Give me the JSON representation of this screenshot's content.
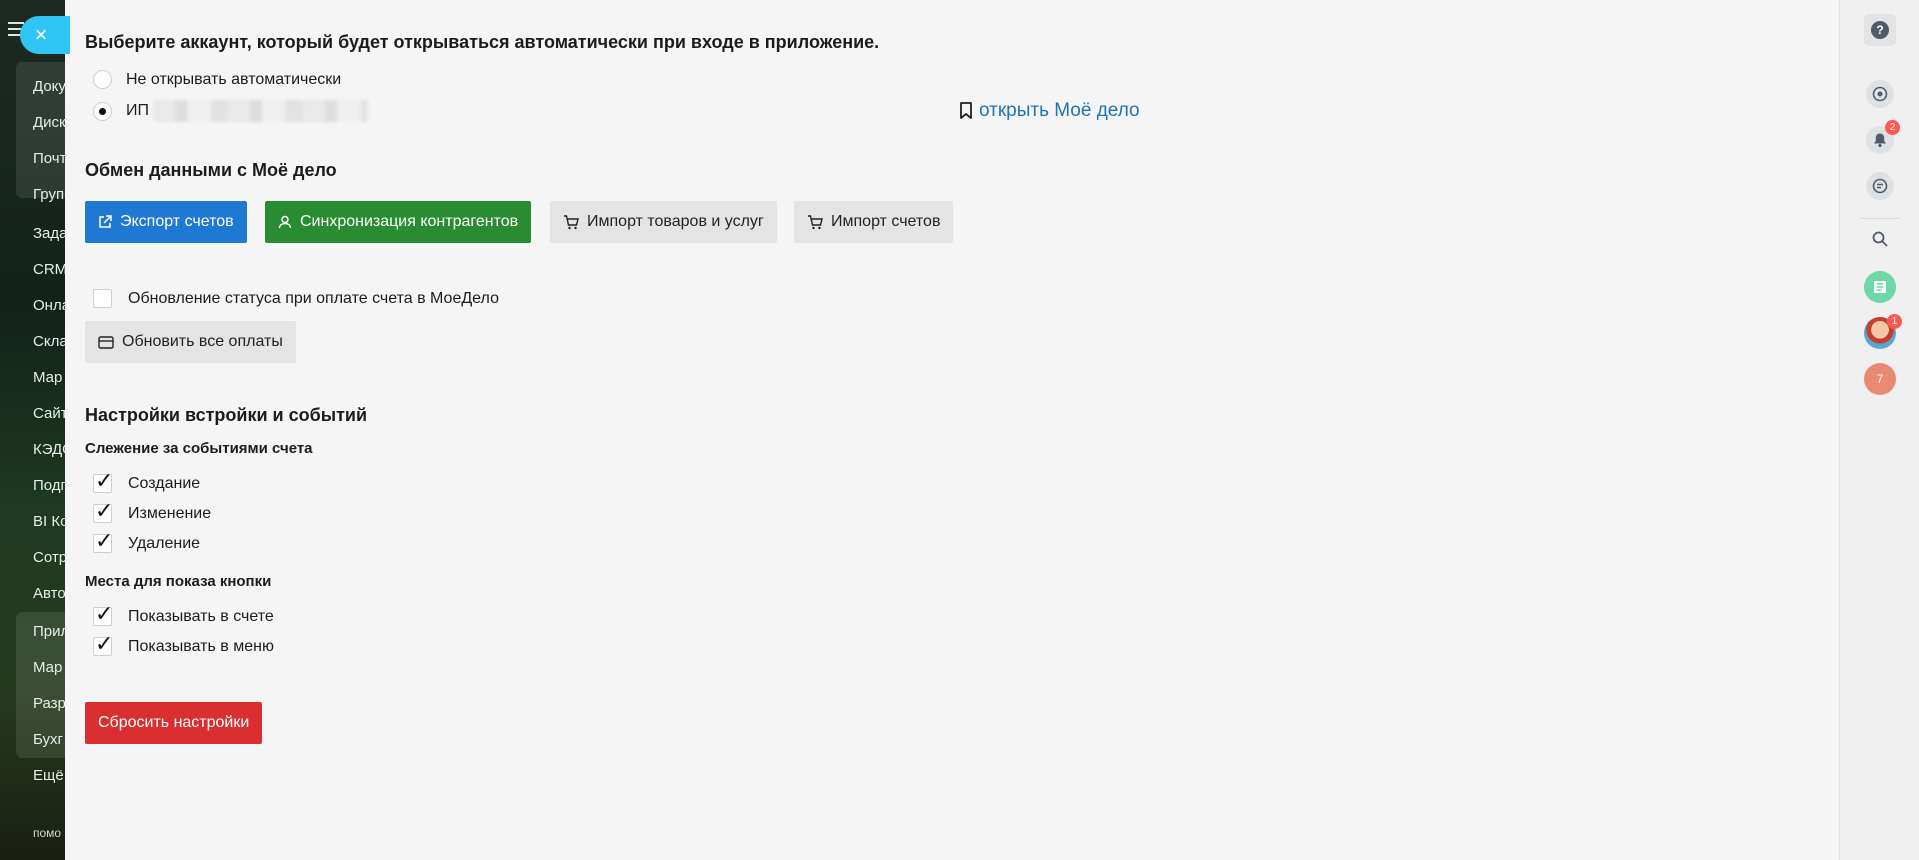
{
  "bg_sidebar": {
    "items": [
      "Доку",
      "Диск",
      "Почт",
      "Груп",
      "Зада",
      "CRM",
      "Онла",
      "Скла",
      "Мар",
      "Сайт",
      "КЭДО",
      "Подп",
      "BI Ко",
      "Сотр",
      "Авто",
      "Прил",
      "Мар",
      "Разр",
      "Бухг",
      "Ещё"
    ],
    "help": "помо"
  },
  "close_icon": "×",
  "account": {
    "title": "Выберите аккаунт, который будет открываться автоматически при входе в приложение.",
    "options": [
      "Не открывать автоматически",
      "ИП"
    ],
    "open_link": "открыть Моё дело"
  },
  "exchange": {
    "title": "Обмен данными с Моё дело",
    "buttons": {
      "export": "Экспорт счетов",
      "sync": "Синхронизация контрагентов",
      "import_goods": "Импорт товаров и услуг",
      "import_invoices": "Импорт счетов"
    },
    "status_update_label": "Обновление статуса при оплате счета в МоеДело",
    "update_payments": "Обновить все оплаты"
  },
  "settings": {
    "title": "Настройки встройки и событий",
    "events_title": "Слежение за событиями счета",
    "events": [
      "Создание",
      "Изменение",
      "Удаление"
    ],
    "places_title": "Места для показа кнопки",
    "places": [
      "Показывать в счете",
      "Показывать в меню"
    ],
    "reset": "Сбросить настройки"
  },
  "right_bar": {
    "help": "?",
    "notifications_badge": "2",
    "user_badge": "1",
    "counter": "7"
  },
  "colors": {
    "blue": "#1f78d1",
    "green": "#2a8c32",
    "red": "#d92f30",
    "link": "#1f73b7",
    "accent": "#2fc6f6"
  }
}
